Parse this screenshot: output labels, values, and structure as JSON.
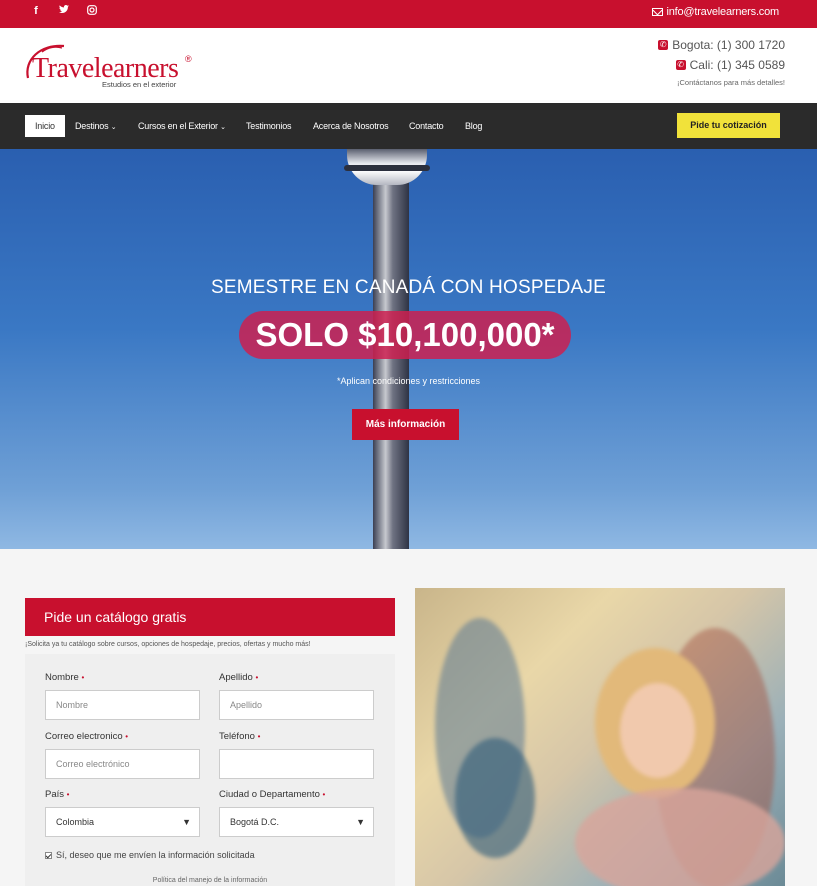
{
  "topbar": {
    "social": [
      {
        "icon": "facebook-icon",
        "glyph": "f"
      },
      {
        "icon": "twitter-icon",
        "glyph": "🐦"
      },
      {
        "icon": "instagram-icon",
        "glyph": "◎"
      }
    ],
    "email": "info@travelearners.com"
  },
  "header": {
    "logo_text": "Travelearners",
    "logo_reg": "®",
    "logo_tagline": "Estudios en el exterior",
    "phones": [
      {
        "label": "Bogota: (1) 300 1720"
      },
      {
        "label": "Cali: (1) 345 0589"
      }
    ],
    "contact_note": "¡Contáctanos para más detalles!"
  },
  "nav": {
    "items": [
      {
        "label": "Inicio",
        "active": true
      },
      {
        "label": "Destinos",
        "dropdown": true
      },
      {
        "label": "Cursos en el Exterior",
        "dropdown": true
      },
      {
        "label": "Testimonios"
      },
      {
        "label": "Acerca de Nosotros"
      },
      {
        "label": "Contacto"
      },
      {
        "label": "Blog"
      }
    ],
    "cta": "Pide tu cotización"
  },
  "hero": {
    "title": "SEMESTRE EN CANADÁ CON HOSPEDAJE",
    "price": "SOLO $10,100,000*",
    "conditions": "*Aplican condiciones y restricciones",
    "button": "Más información"
  },
  "form": {
    "title": "Pide un catálogo gratis",
    "subtitle": "¡Solicita ya tu catálogo sobre cursos, opciones de hospedaje, precios, ofertas y mucho más!",
    "required_mark": "•",
    "fields": {
      "nombre": {
        "label": "Nombre",
        "placeholder": "Nombre"
      },
      "apellido": {
        "label": "Apellido",
        "placeholder": "Apellido"
      },
      "correo": {
        "label": "Correo electronico",
        "placeholder": "Correo electrónico"
      },
      "telefono": {
        "label": "Teléfono",
        "placeholder": ""
      },
      "pais": {
        "label": "País",
        "value": "Colombia"
      },
      "ciudad": {
        "label": "Ciudad o Departamento",
        "value": "Bogotá D.C."
      }
    },
    "consent": "Sí, deseo que me envíen la información solicitada",
    "consent_checked": true,
    "policy": "Política del manejo de la información"
  },
  "colors": {
    "brand": "#c8102e",
    "nav_bg": "#2b2b2b",
    "cta_yellow": "#f1e23a"
  }
}
